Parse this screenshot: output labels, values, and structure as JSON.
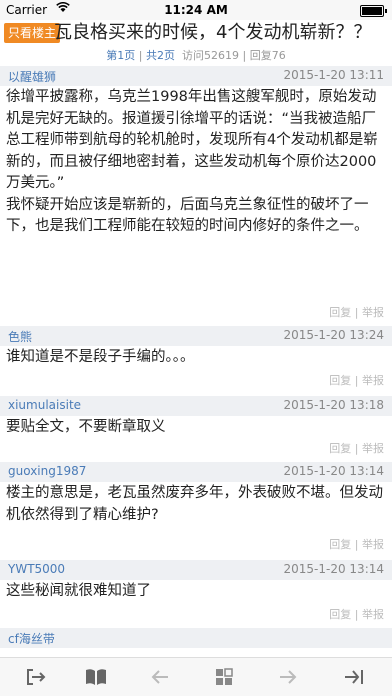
{
  "status": {
    "carrier": "Carrier",
    "time": "11:24 AM"
  },
  "thread": {
    "badge": "只看楼主",
    "title": "瓦良格买来的时候，4个发动机崭新？？",
    "page_current": "第1页",
    "page_sep": " | ",
    "page_total": "共2页",
    "views": "访问52619",
    "replies": "回复76"
  },
  "actions": {
    "reply": "回复",
    "sep": " | ",
    "report": "举报"
  },
  "posts": [
    {
      "author": "以醒雄狮",
      "time": "2015-1-20 13:11",
      "content": "徐增平披露称，乌克兰1998年出售这艘军舰时，原始发动机是完好无缺的。报道援引徐增平的话说：“当我被造船厂总工程师带到航母的轮机舱时，发现所有4个发动机都是崭新的，而且被仔细地密封着，这些发动机每个原价达2000万美元。”\n我怀疑开始应该是崭新的，后面乌克兰象征性的破坏了一下，也是我们工程师能在较短的时间内修好的条件之一。"
    },
    {
      "author": "色熊",
      "time": "2015-1-20 13:24",
      "content": "谁知道是不是段子手编的。。。"
    },
    {
      "author": "xiumulaisite",
      "time": "2015-1-20 13:18",
      "content": "要贴全文，不要断章取义"
    },
    {
      "author": "guoxing1987",
      "time": "2015-1-20 13:14",
      "content": "楼主的意思是，老瓦虽然废弃多年，外表破败不堪。但发动机依然得到了精心维护?"
    },
    {
      "author": "YWT5000",
      "time": "2015-1-20 13:14",
      "content": "这些秘闻就很难知道了"
    },
    {
      "author": "cf海丝带",
      "time": "",
      "content": ""
    }
  ],
  "toolbar": {
    "icons": [
      "back-to-list-icon",
      "book-icon",
      "prev-page-icon",
      "page-grid-icon",
      "next-page-icon",
      "last-page-icon"
    ]
  }
}
